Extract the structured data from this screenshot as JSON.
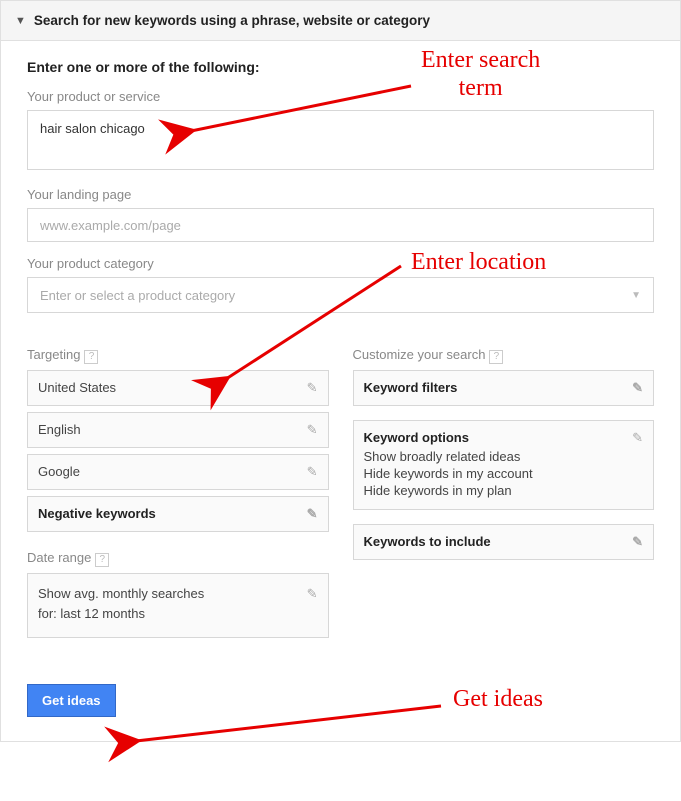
{
  "header": {
    "title": "Search for new keywords using a phrase, website or category"
  },
  "intro": {
    "title": "Enter one or more of the following:"
  },
  "product": {
    "label": "Your product or service",
    "value": "hair salon chicago"
  },
  "landing": {
    "label": "Your landing page",
    "placeholder": "www.example.com/page"
  },
  "category": {
    "label": "Your product category",
    "placeholder": "Enter or select a product category"
  },
  "targeting": {
    "label": "Targeting",
    "location": "United States",
    "language": "English",
    "network": "Google",
    "negative": "Negative keywords"
  },
  "daterange": {
    "label": "Date range",
    "line1": "Show avg. monthly searches",
    "line2": "for: last 12 months"
  },
  "customize": {
    "label": "Customize your search",
    "filters_title": "Keyword filters",
    "options_title": "Keyword options",
    "opt1": "Show broadly related ideas",
    "opt2": "Hide keywords in my account",
    "opt3": "Hide keywords in my plan",
    "include_title": "Keywords to include"
  },
  "button": {
    "label": "Get ideas"
  },
  "annotations": {
    "a1_line1": "Enter search",
    "a1_line2": "term",
    "a2": "Enter location",
    "a3": "Get ideas"
  },
  "help": "?"
}
